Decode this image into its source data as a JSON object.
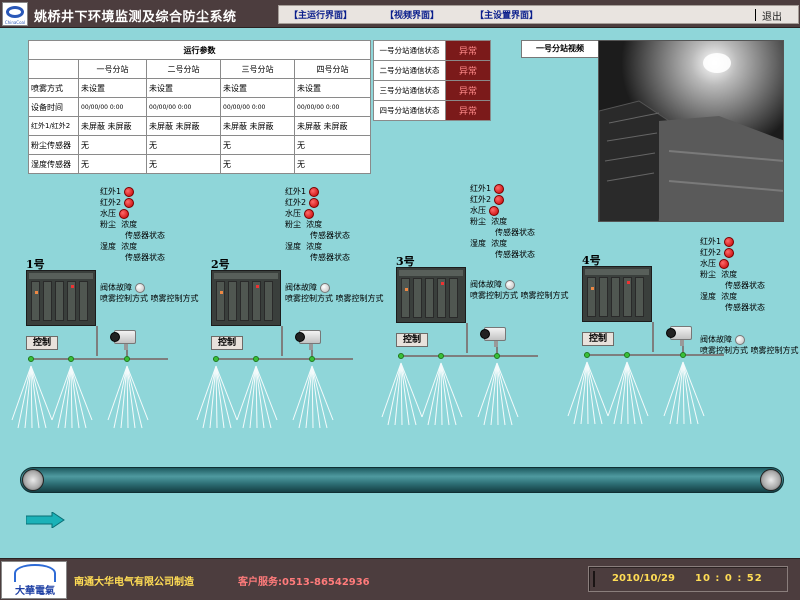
{
  "header": {
    "title": "姚桥井下环境监测及综合防尘系统",
    "nav": [
      "【主运行界面】",
      "【视频界面】",
      "【主设置界面】"
    ],
    "exit": "退出"
  },
  "params": {
    "title": "运行参数",
    "columns": [
      "一号分站",
      "二号分站",
      "三号分站",
      "四号分站"
    ],
    "rows": [
      {
        "label": "喷雾方式",
        "values": [
          "未设置",
          "未设置",
          "未设置",
          "未设置"
        ]
      },
      {
        "label": "设备时间",
        "values": [
          "00/00/00 0:00",
          "00/00/00 0:00",
          "00/00/00 0:00",
          "00/00/00 0:00"
        ]
      },
      {
        "label": "红外1/红外2",
        "values": [
          "未屏蔽 未屏蔽",
          "未屏蔽 未屏蔽",
          "未屏蔽 未屏蔽",
          "未屏蔽 未屏蔽"
        ]
      },
      {
        "label": "粉尘传感器",
        "values": [
          "无",
          "无",
          "无",
          "无"
        ]
      },
      {
        "label": "湿度传感器",
        "values": [
          "无",
          "无",
          "无",
          "无"
        ]
      }
    ]
  },
  "comm": [
    {
      "name": "一号分站通信状态",
      "status": "异常"
    },
    {
      "name": "二号分站通信状态",
      "status": "异常"
    },
    {
      "name": "三号分站通信状态",
      "status": "异常"
    },
    {
      "name": "四号分站通信状态",
      "status": "异常"
    }
  ],
  "video": {
    "title": "一号分站视频"
  },
  "stations": [
    {
      "label": "1号",
      "ctrl": "控制",
      "s": [
        "红外1",
        "红外2",
        "水压",
        "粉尘",
        "浓度",
        "传感器状态",
        "湿度",
        "浓度",
        "传感器状态"
      ],
      "valve": "阀体故障",
      "spray1": "喷雾控制方式",
      "spray2": "喷雾控制方式"
    },
    {
      "label": "2号",
      "ctrl": "控制",
      "s": [
        "红外1",
        "红外2",
        "水压",
        "粉尘",
        "浓度",
        "传感器状态",
        "湿度",
        "浓度",
        "传感器状态"
      ],
      "valve": "阀体故障",
      "spray1": "喷雾控制方式",
      "spray2": "喷雾控制方式"
    },
    {
      "label": "3号",
      "ctrl": "控制",
      "s": [
        "红外1",
        "红外2",
        "水压",
        "粉尘",
        "浓度",
        "传感器状态",
        "湿度",
        "浓度",
        "传感器状态"
      ],
      "valve": "阀体故障",
      "spray1": "喷雾控制方式",
      "spray2": "喷雾控制方式"
    },
    {
      "label": "4号",
      "ctrl": "控制",
      "s": [
        "红外1",
        "红外2",
        "水压",
        "粉尘",
        "浓度",
        "传感器状态",
        "湿度",
        "浓度",
        "传感器状态"
      ],
      "valve": "阀体故障",
      "spray1": "喷雾控制方式",
      "spray2": "喷雾控制方式"
    }
  ],
  "footer": {
    "logo_text": "大華電氣",
    "company": "南通大华电气有限公司制造",
    "service": "客户服务:0513-86542936",
    "date": "2010/10/29",
    "time": "10 : 0 : 52"
  },
  "colors": {
    "bg": "#8fd6d9",
    "header": "#4c3d3e",
    "status_bg": "#7b1a1a",
    "lamp_red": "#c40000"
  }
}
